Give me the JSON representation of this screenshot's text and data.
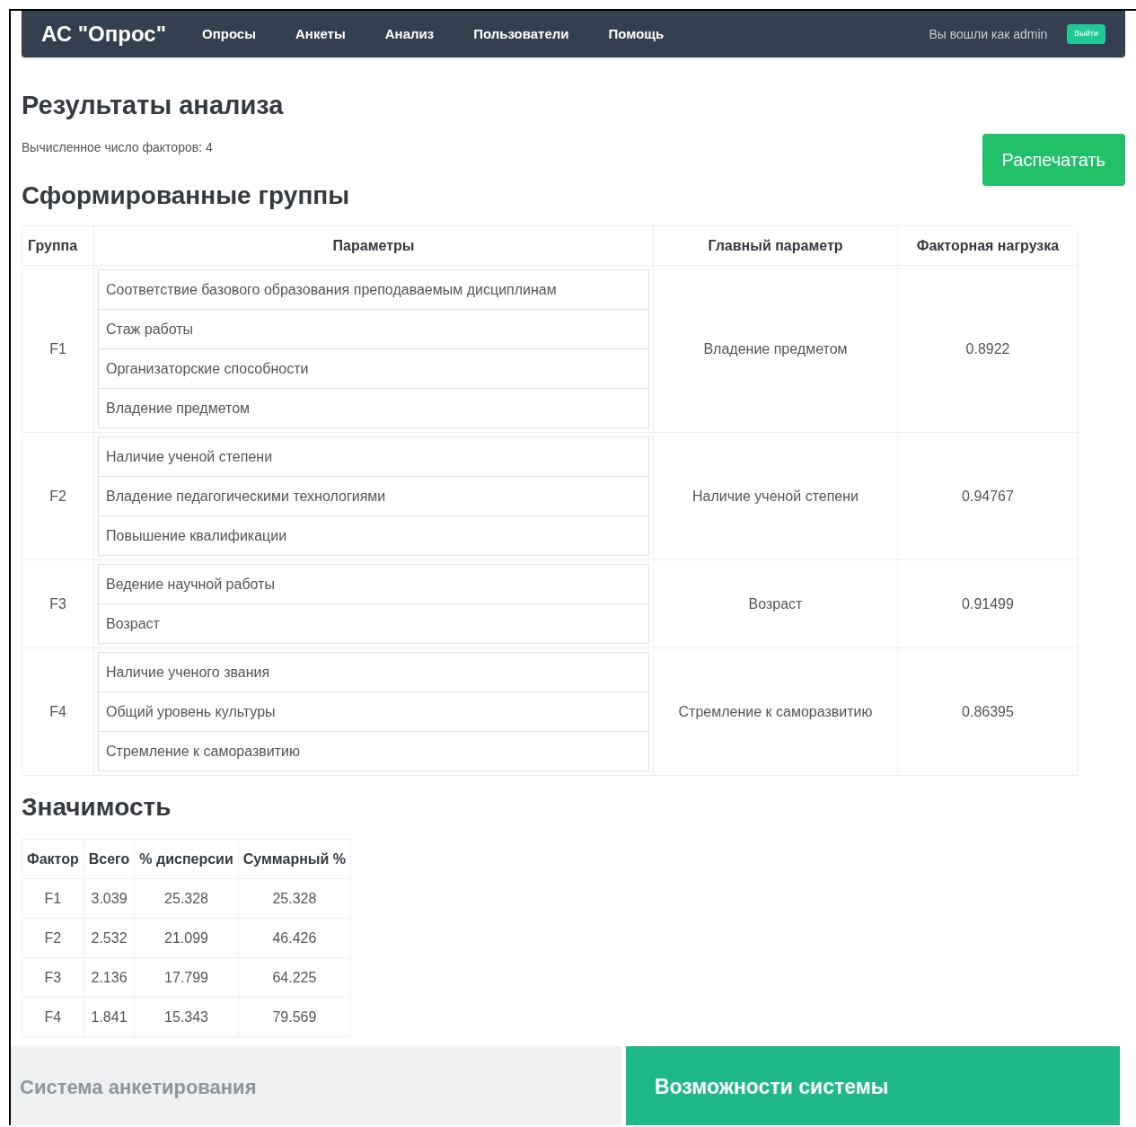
{
  "navbar": {
    "brand": "АС \"Опрос\"",
    "links": [
      "Опросы",
      "Анкеты",
      "Анализ",
      "Пользователи",
      "Помощь"
    ],
    "user_text": "Вы вошли как admin",
    "logout_button": "Выйти"
  },
  "title": "Результаты анализа",
  "factors_text": "Вычисленное число факторов: 4",
  "print_button": "Распечатать",
  "groups": {
    "heading": "Сформированные группы",
    "columns": [
      "Группа",
      "Параметры",
      "Главный параметр",
      "Факторная нагрузка"
    ],
    "rows": [
      {
        "group": "F1",
        "parameters": [
          "Соответствие базового образования преподаваемым дисциплинам",
          "Стаж работы",
          "Организаторские способности",
          "Владение предметом"
        ],
        "main": "Владение предметом",
        "loading": "0.8922"
      },
      {
        "group": "F2",
        "parameters": [
          "Наличие ученой степени",
          "Владение педагогическими технологиями",
          "Повышение квалификации"
        ],
        "main": "Наличие ученой степени",
        "loading": "0.94767"
      },
      {
        "group": "F3",
        "parameters": [
          "Ведение научной работы",
          "Возраст"
        ],
        "main": "Возраст",
        "loading": "0.91499"
      },
      {
        "group": "F4",
        "parameters": [
          "Наличие ученого звания",
          "Общий уровень культуры",
          "Стремление к саморазвитию"
        ],
        "main": "Стремление к саморазвитию",
        "loading": "0.86395"
      }
    ]
  },
  "significance": {
    "heading": "Значимость",
    "columns": [
      "Фактор",
      "Всего",
      "% дисперсии",
      "Суммарный %"
    ],
    "rows": [
      [
        "F1",
        "3.039",
        "25.328",
        "25.328"
      ],
      [
        "F2",
        "2.532",
        "21.099",
        "46.426"
      ],
      [
        "F3",
        "2.136",
        "17.799",
        "64.225"
      ],
      [
        "F4",
        "1.841",
        "15.343",
        "79.569"
      ]
    ]
  },
  "footer": {
    "left_text": "Система анкетирования",
    "right_text": "Возможности системы"
  }
}
